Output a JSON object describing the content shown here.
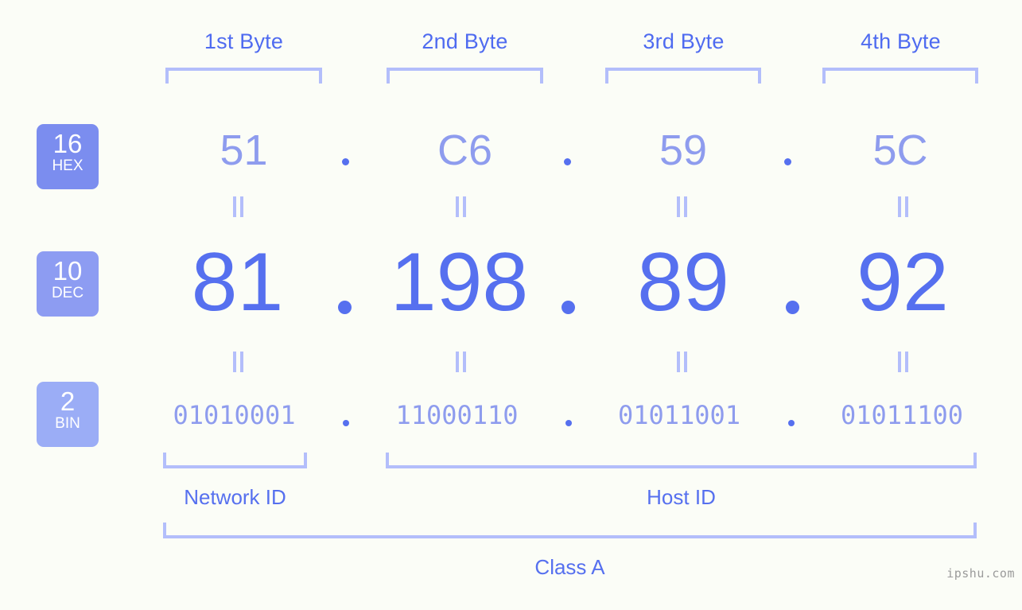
{
  "background_color": "#fbfdf7",
  "colors": {
    "accent_strong": "#5670ef",
    "accent_mid": "#8e9cee",
    "accent_light": "#b3befb",
    "header_text": "#4f6bf0",
    "badge_hex": "#7b8def",
    "badge_dec": "#8d9cf2",
    "badge_bin": "#9badf6",
    "watermark": "#9b9b9b"
  },
  "byte_headers": [
    {
      "label": "1st Byte"
    },
    {
      "label": "2nd Byte"
    },
    {
      "label": "3rd Byte"
    },
    {
      "label": "4th Byte"
    }
  ],
  "radix_badges": [
    {
      "number": "16",
      "label": "HEX"
    },
    {
      "number": "10",
      "label": "DEC"
    },
    {
      "number": "2",
      "label": "BIN"
    }
  ],
  "rows": {
    "hex": {
      "values": [
        "51",
        "C6",
        "59",
        "5C"
      ],
      "separator": "."
    },
    "dec": {
      "values": [
        "81",
        "198",
        "89",
        "92"
      ],
      "separator": "."
    },
    "bin": {
      "values": [
        "01010001",
        "11000110",
        "01011001",
        "01011100"
      ],
      "separator": "."
    }
  },
  "equals_marks": {
    "glyph": "||",
    "rows": 2,
    "per_row": 4
  },
  "segments": [
    {
      "label": "Network ID"
    },
    {
      "label": "Host ID"
    }
  ],
  "class_label": "Class A",
  "watermark": "ipshu.com"
}
